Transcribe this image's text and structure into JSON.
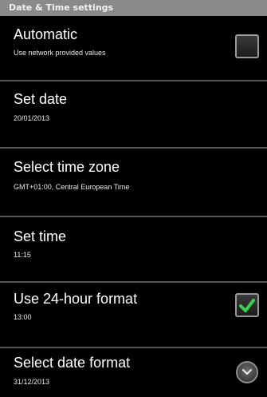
{
  "header": {
    "title": "Date & Time settings"
  },
  "items": [
    {
      "title": "Automatic",
      "summary": "Use network provided values",
      "control": "checkbox",
      "checked": false
    },
    {
      "title": "Set date",
      "summary": "20/01/2013"
    },
    {
      "title": "Select time zone",
      "summary": "GMT+01:00, Central European Time"
    },
    {
      "title": "Set time",
      "summary": "11:15"
    },
    {
      "title": "Use 24-hour format",
      "summary": "13:00",
      "control": "checkbox",
      "checked": true
    },
    {
      "title": "Select date format",
      "summary": "31/12/2013",
      "control": "dropdown"
    }
  ],
  "colors": {
    "header_bg": "#8a8a8a",
    "checkmark": "#35d34a",
    "divider": "#555555"
  },
  "icons": [
    "check-icon",
    "chevron-down-icon"
  ]
}
